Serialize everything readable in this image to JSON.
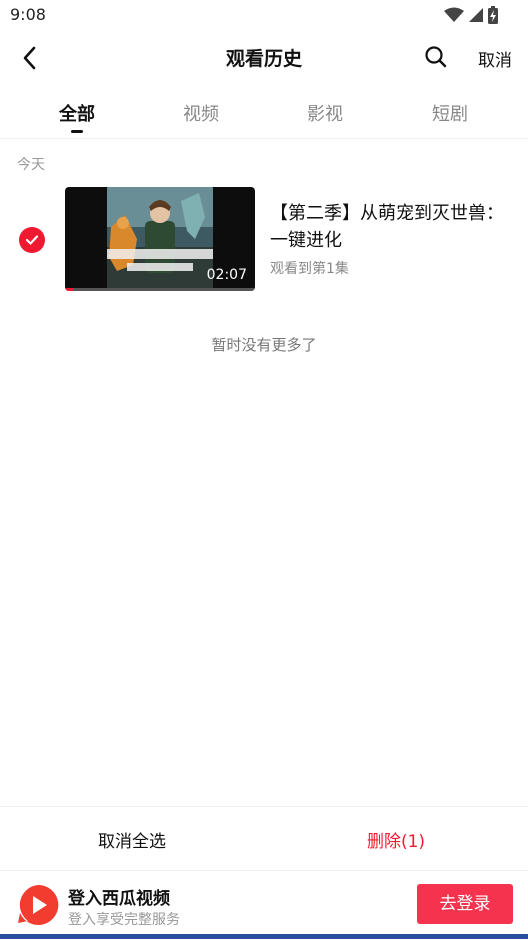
{
  "status_bar": {
    "time": "9:08"
  },
  "nav": {
    "title": "观看历史",
    "cancel_label": "取消"
  },
  "tabs": [
    {
      "label": "全部",
      "active": true
    },
    {
      "label": "视频",
      "active": false
    },
    {
      "label": "影视",
      "active": false
    },
    {
      "label": "短剧",
      "active": false
    }
  ],
  "history": {
    "section_label": "今天",
    "items": [
      {
        "selected": true,
        "title": "【第二季】从萌宠到灭世兽：一键进化",
        "subtitle": "观看到第1集",
        "duration": "02:07",
        "progress": 0.04
      }
    ],
    "end_text": "暂时没有更多了"
  },
  "actions": {
    "unselect_all_label": "取消全选",
    "delete_label": "删除(1)"
  },
  "login_banner": {
    "title": "登入西瓜视频",
    "subtitle": "登入享受完整服务",
    "button_label": "去登录"
  },
  "colors": {
    "accent": "#f01a30",
    "login_button": "#f5334f"
  }
}
